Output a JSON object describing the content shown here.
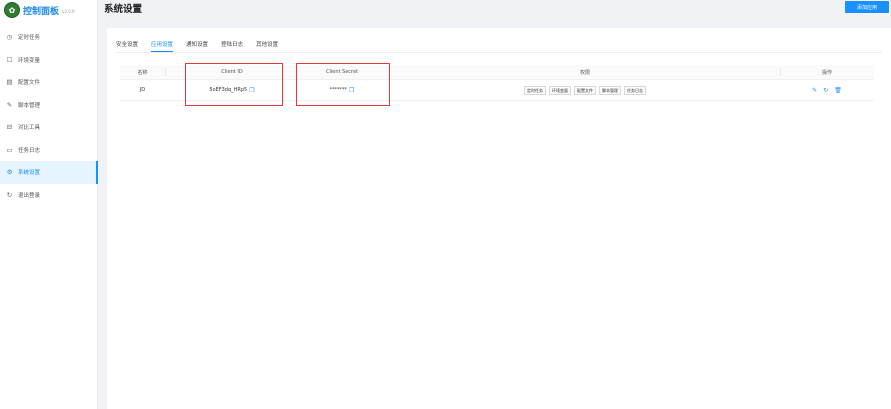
{
  "brand": {
    "title": "控制面板",
    "version": "v2.0.0"
  },
  "header": {
    "title": "系统设置",
    "add_button": "添加应用"
  },
  "sidebar": {
    "items": [
      {
        "label": "定时任务",
        "icon": "clock-icon",
        "glyph": "◷"
      },
      {
        "label": "环境变量",
        "icon": "env-icon",
        "glyph": "☐"
      },
      {
        "label": "配置文件",
        "icon": "config-icon",
        "glyph": "▤"
      },
      {
        "label": "脚本管理",
        "icon": "script-icon",
        "glyph": "✎"
      },
      {
        "label": "对比工具",
        "icon": "diff-icon",
        "glyph": "⊟"
      },
      {
        "label": "任务日志",
        "icon": "folder-icon",
        "glyph": "▭"
      },
      {
        "label": "系统设置",
        "icon": "settings-icon",
        "glyph": "⚙",
        "active": true
      },
      {
        "label": "退出登录",
        "icon": "logout-icon",
        "glyph": "↻"
      }
    ]
  },
  "tabs": [
    "安全设置",
    "应用设置",
    "通知设置",
    "登陆日志",
    "其他设置"
  ],
  "table": {
    "headers": {
      "name": "名称",
      "client_id": "Client ID",
      "client_secret": "Client Secret",
      "scopes": "权限",
      "actions": "操作"
    },
    "rows": [
      {
        "name": "JD",
        "client_id": "5oEF3dq_HRp5",
        "client_secret": "*******",
        "scopes": [
          "定时任务",
          "环境变量",
          "配置文件",
          "脚本管理",
          "任务日志"
        ]
      }
    ]
  },
  "colors": {
    "accent": "#1890ff",
    "highlight": "#e53935"
  }
}
